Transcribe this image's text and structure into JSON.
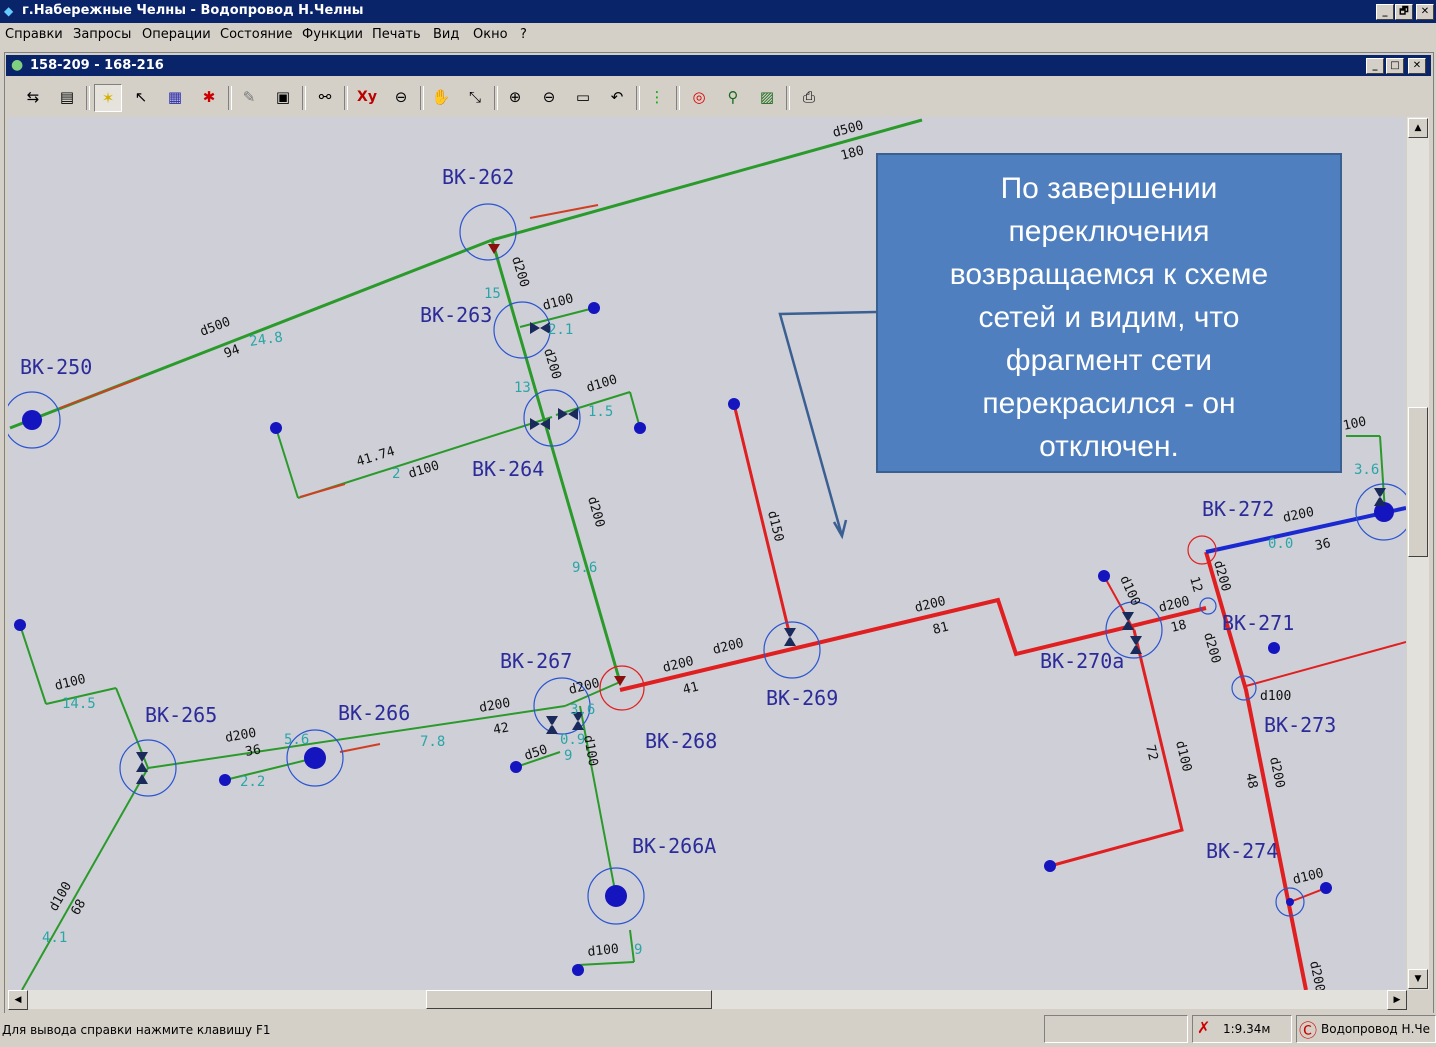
{
  "app": {
    "title": "г.Набережные Челны - Водопровод Н.Челны",
    "window_buttons": [
      "_",
      "🗗",
      "✕"
    ]
  },
  "menu": {
    "items": [
      "Справки",
      "Запросы",
      "Операции",
      "Состояние",
      "Функции",
      "Печать",
      "Вид",
      "Окно",
      "?"
    ]
  },
  "document": {
    "title": "158-209 - 168-216",
    "window_buttons": [
      "_",
      "□",
      "✕"
    ]
  },
  "toolbar": {
    "icons": [
      "map-export-icon",
      "document-icon",
      "select-pointer-icon",
      "pointer-icon",
      "area-select-icon",
      "node-select-icon",
      "eraser-icon",
      "info-pointer-icon",
      "binoculars-icon",
      "xy-coordinates-icon",
      "magnifier-icon",
      "hand-pan-icon",
      "measure-icon",
      "zoom-in-icon",
      "zoom-out-icon",
      "zoom-window-icon",
      "undo-view-icon",
      "traffic-light-icon",
      "target-icon",
      "network-trace-icon",
      "picture-icon",
      "printer-icon"
    ],
    "xy_label": "Xy"
  },
  "map": {
    "nodes": {
      "vk262": "ВК-262",
      "vk263": "ВК-263",
      "vk250": "ВК-250",
      "vk264": "ВК-264",
      "vk265": "ВК-265",
      "vk266": "ВК-266",
      "vk267": "ВК-267",
      "vk268": "ВК-268",
      "vk269": "ВК-269",
      "vk266a": "ВК-266А",
      "vk270a": "ВК-270а",
      "vk271": "ВК-271",
      "vk272": "ВК-272",
      "vk273": "ВК-273",
      "vk274": "ВК-274"
    },
    "pipe_labels": {
      "d500_top": "d500",
      "n180": "180",
      "d500_left": "d500",
      "n94": "94",
      "d200_263": "d200",
      "d100_263": "d100",
      "d200_264": "d200",
      "d100_264": "d100",
      "n41_74": "41.74",
      "d100_left": "d100",
      "d200_mid": "d200",
      "d150": "d150",
      "d200_a": "d200",
      "d200_b": "d200",
      "n41": "41",
      "d200_c": "d200",
      "n81": "81",
      "d100_265": "d100",
      "d200_265": "d200",
      "n36": "36",
      "d200_266": "d200",
      "n42": "42",
      "d200_267": "d200",
      "d50": "d50",
      "d100_267": "d100",
      "d100_266a": "d100",
      "d100_bl": "d100",
      "n68": "68",
      "d100_270": "d100",
      "d200_270": "d200",
      "n18": "18",
      "d200_272": "d200",
      "n36b": "36",
      "n12": "12",
      "d200_271": "d200",
      "d200_271b": "d200",
      "d100_273": "d100",
      "d200_273": "d200",
      "n48": "48",
      "n72": "72",
      "d100_vert": "d100",
      "d100_274": "d100",
      "d200_bot": "d200",
      "n100_right": "100"
    },
    "length_labels": {
      "l24_8": "24.8",
      "l15": "15",
      "l2_1": "2.1",
      "l13": "13",
      "l1_5": "1.5",
      "l2": "2",
      "l9_6": "9.6",
      "l14_5": "14.5",
      "l5_6": "5.6",
      "l7_8": "7.8",
      "l2_2": "2.2",
      "l3_6": "3.6",
      "l0_0": "0.0",
      "l4_1": "4.1",
      "l9": "9",
      "l3_6b": "3.6",
      "l0_9": "0.9",
      "l9b": "9"
    }
  },
  "callout": {
    "lines": [
      "По  завершении",
      "переключения",
      "возвращаемся к схеме",
      "сетей и видим, что",
      "фрагмент сети",
      "перекрасился  - он",
      "отключен."
    ]
  },
  "status": {
    "hint": "Для вывода справки нажмите клавишу F1",
    "scale": "1:9.34м",
    "layer": "Водопровод Н.Че"
  },
  "colors": {
    "active_pipe": "#2a9a2a",
    "disabled_pipe": "#e02020",
    "other_pipe": "#1a2ad0",
    "callout_bg": "#4f7fbf",
    "title_bar": "#0a246a"
  }
}
